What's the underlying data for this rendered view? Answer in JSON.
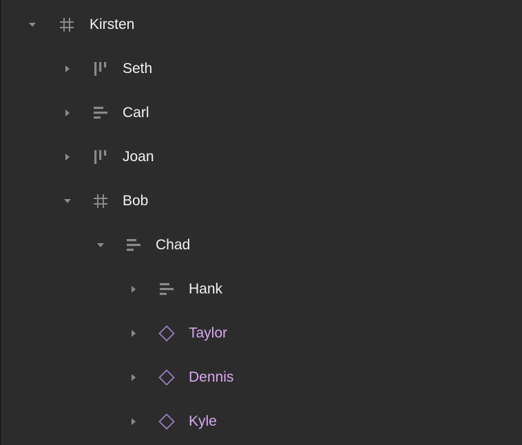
{
  "layers_panel": {
    "colors": {
      "background": "#2c2c2c",
      "text": "#f2f2f2",
      "component_text": "#d8a8f2",
      "icon": "#8a8a8a",
      "component_icon": "#9a7ec4"
    },
    "items": [
      {
        "label": "Kirsten",
        "icon": "frame-icon",
        "expanded": true,
        "depth": 0
      },
      {
        "label": "Seth",
        "icon": "auto-layout-horizontal-icon",
        "expanded": false,
        "depth": 1
      },
      {
        "label": "Carl",
        "icon": "auto-layout-vertical-icon",
        "expanded": false,
        "depth": 1
      },
      {
        "label": "Joan",
        "icon": "auto-layout-horizontal-icon",
        "expanded": false,
        "depth": 1
      },
      {
        "label": "Bob",
        "icon": "frame-icon",
        "expanded": true,
        "depth": 1
      },
      {
        "label": "Chad",
        "icon": "auto-layout-vertical-icon",
        "expanded": true,
        "depth": 2
      },
      {
        "label": "Hank",
        "icon": "auto-layout-vertical-icon",
        "expanded": false,
        "depth": 3
      },
      {
        "label": "Taylor",
        "icon": "component-instance-icon",
        "expanded": false,
        "depth": 3
      },
      {
        "label": "Dennis",
        "icon": "component-instance-icon",
        "expanded": false,
        "depth": 3
      },
      {
        "label": "Kyle",
        "icon": "component-instance-icon",
        "expanded": false,
        "depth": 3
      }
    ]
  }
}
